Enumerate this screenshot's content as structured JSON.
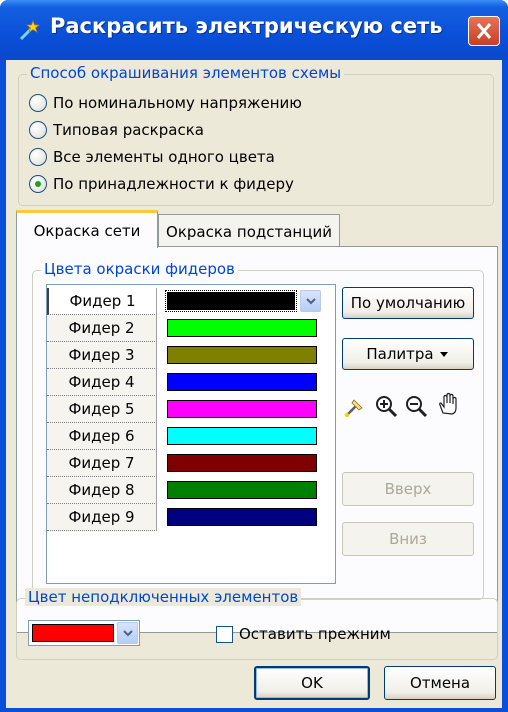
{
  "window": {
    "title": "Раскрасить электрическую сеть"
  },
  "coloring_method": {
    "legend": "Способ окрашивания элементов схемы",
    "options": [
      {
        "label": "По номинальному напряжению",
        "checked": false
      },
      {
        "label": "Типовая раскраска",
        "checked": false
      },
      {
        "label": "Все элементы одного цвета",
        "checked": false
      },
      {
        "label": "По принадлежности к фидеру",
        "checked": true
      }
    ]
  },
  "tabs": [
    {
      "label": "Окраска сети",
      "active": true
    },
    {
      "label": "Окраска подстанций",
      "active": false
    }
  ],
  "feeder_colors": {
    "legend": "Цвета окраски фидеров",
    "rows": [
      {
        "name": "Фидер 1",
        "color": "#000000"
      },
      {
        "name": "Фидер 2",
        "color": "#00ff00"
      },
      {
        "name": "Фидер 3",
        "color": "#808000"
      },
      {
        "name": "Фидер 4",
        "color": "#0000ff"
      },
      {
        "name": "Фидер 5",
        "color": "#ff00ff"
      },
      {
        "name": "Фидер 6",
        "color": "#00ffff"
      },
      {
        "name": "Фидер 7",
        "color": "#800000"
      },
      {
        "name": "Фидер 8",
        "color": "#008000"
      },
      {
        "name": "Фидер 9",
        "color": "#000080"
      }
    ],
    "buttons": {
      "default": "По умолчанию",
      "palette": "Палитра",
      "up": "Вверх",
      "down": "Вниз"
    },
    "tools": [
      "picker-icon",
      "zoom-in-icon",
      "zoom-out-icon",
      "hand-icon"
    ]
  },
  "unconnected": {
    "legend": "Цвет неподключенных элементов",
    "color": "#ff0000",
    "keep_label": "Оставить прежним",
    "keep_checked": false
  },
  "footer": {
    "ok": "OK",
    "cancel": "Отмена"
  }
}
